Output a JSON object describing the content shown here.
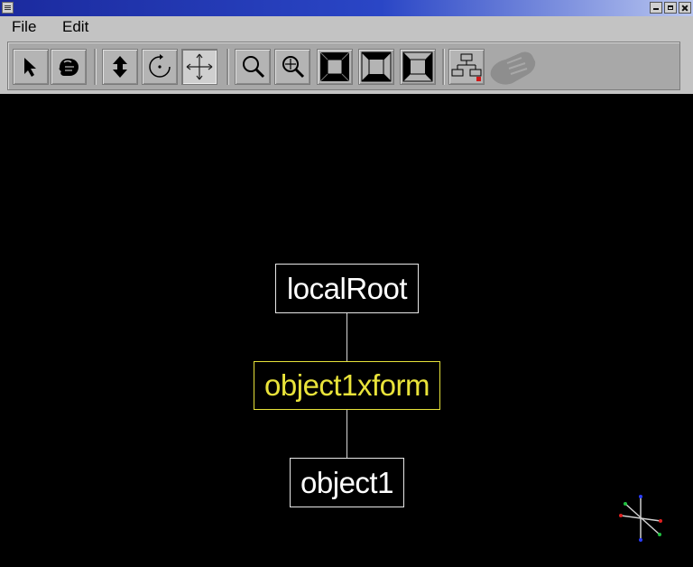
{
  "window": {
    "title": ""
  },
  "menubar": {
    "items": [
      {
        "label": "File"
      },
      {
        "label": "Edit"
      }
    ]
  },
  "toolbar": {
    "tools": [
      {
        "name": "select-arrow-icon",
        "active": false
      },
      {
        "name": "grab-hand-icon",
        "active": false
      },
      {
        "name": "move-updown-icon",
        "active": false
      },
      {
        "name": "rotate-icon",
        "active": false
      },
      {
        "name": "pan-crosshair-icon",
        "active": true
      },
      {
        "name": "zoom-icon",
        "active": false
      },
      {
        "name": "zoom-plus-icon",
        "active": false
      },
      {
        "name": "view-front-icon",
        "active": false
      },
      {
        "name": "view-top-icon",
        "active": false
      },
      {
        "name": "view-side-icon",
        "active": false
      },
      {
        "name": "scene-graph-icon",
        "active": false
      }
    ]
  },
  "graph": {
    "nodes": [
      {
        "label": "localRoot",
        "selected": false
      },
      {
        "label": "object1xform",
        "selected": true
      },
      {
        "label": "object1",
        "selected": false
      }
    ]
  },
  "colors": {
    "selection": "#e7e23a",
    "node_text": "#ffffff",
    "canvas": "#000000",
    "ui_gray": "#c3c3c3"
  }
}
